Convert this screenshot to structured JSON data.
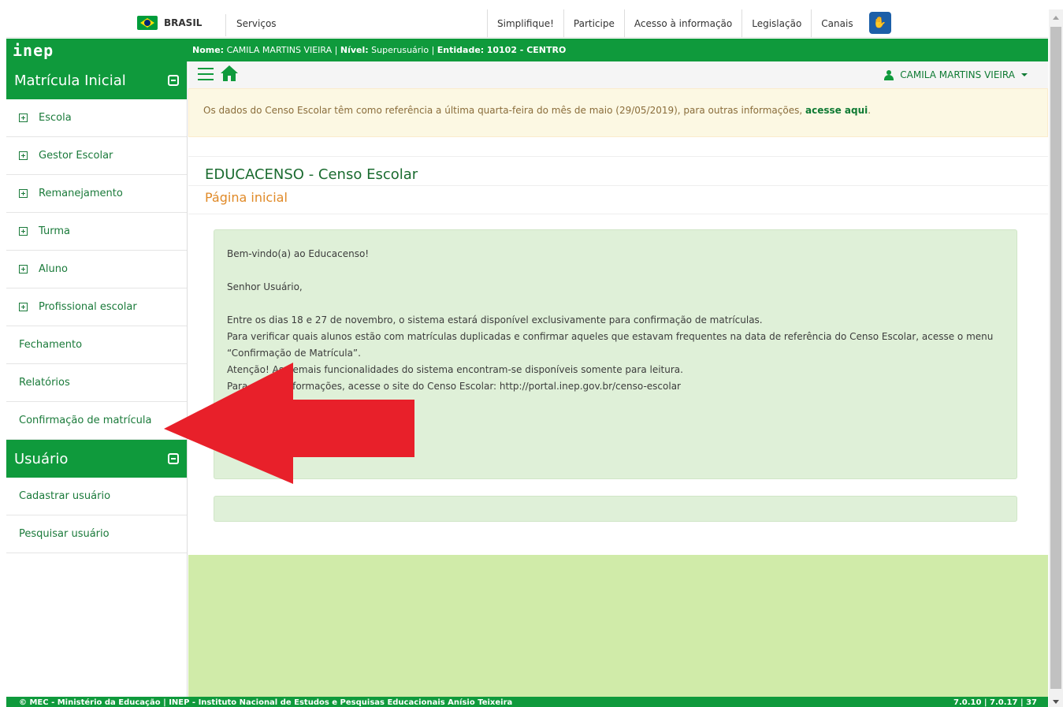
{
  "govbar": {
    "country": "BRASIL",
    "services": "Serviços",
    "links": [
      "Simplifique!",
      "Participe",
      "Acesso à informação",
      "Legislação",
      "Canais"
    ]
  },
  "header": {
    "logo": "inep",
    "user_line": {
      "name_label": "Nome:",
      "name_value": "CAMILA MARTINS VIEIRA",
      "level_label": "Nível:",
      "level_value": "Superusuário",
      "entity_label": "Entidade:",
      "entity_value": "10102 - CENTRO"
    }
  },
  "sidebar": {
    "section1_title": "Matrícula Inicial",
    "section1_items": [
      {
        "label": "Escola"
      },
      {
        "label": "Gestor Escolar"
      },
      {
        "label": "Remanejamento"
      },
      {
        "label": "Turma"
      },
      {
        "label": "Aluno"
      },
      {
        "label": "Profissional escolar"
      },
      {
        "label": "Fechamento"
      },
      {
        "label": "Relatórios"
      },
      {
        "label": "Confirmação de matrícula"
      }
    ],
    "section2_title": "Usuário",
    "section2_items": [
      {
        "label": "Cadastrar usuário"
      },
      {
        "label": "Pesquisar usuário"
      }
    ]
  },
  "toolbar": {
    "user_name": "CAMILA MARTINS VIEIRA"
  },
  "alert": {
    "text": "Os dados do Censo Escolar têm como referência a última quarta-feira do mês de maio (29/05/2019), para outras informações, ",
    "link": "acesse aqui",
    "suffix": "."
  },
  "page": {
    "title": "EDUCACENSO - Censo Escolar",
    "subtitle": "Página inicial"
  },
  "welcome": {
    "greeting": "Bem-vindo(a) ao Educacenso!",
    "salutation": "Senhor Usuário,",
    "line1": "Entre os dias 18 e 27 de novembro, o sistema estará disponível exclusivamente para confirmação de matrículas.",
    "line2": "Para verificar quais alunos estão com matrículas duplicadas e confirmar aqueles que estavam frequentes na data de referência do Censo Escolar, acesse o menu “Confirmação de Matrícula”.",
    "line3": "Atenção! As demais funcionalidades do sistema encontram-se disponíveis somente para leitura.",
    "line4": "Para outras informações, acesse o site do Censo Escolar: http://portal.inep.gov.br/censo-escolar"
  },
  "footer": {
    "left": "© MEC - Ministério da Educação | INEP - Instituto Nacional de Estudos e Pesquisas Educacionais Anísio Teixeira",
    "right": "7.0.10 | 7.0.17 | 37"
  },
  "colors": {
    "primary_green": "#0f9a3c",
    "alert_bg": "#fcf8e3",
    "welcome_bg": "#dff0d8",
    "bottom_bg": "#d0eba9",
    "arrow_red": "#e8202a"
  }
}
